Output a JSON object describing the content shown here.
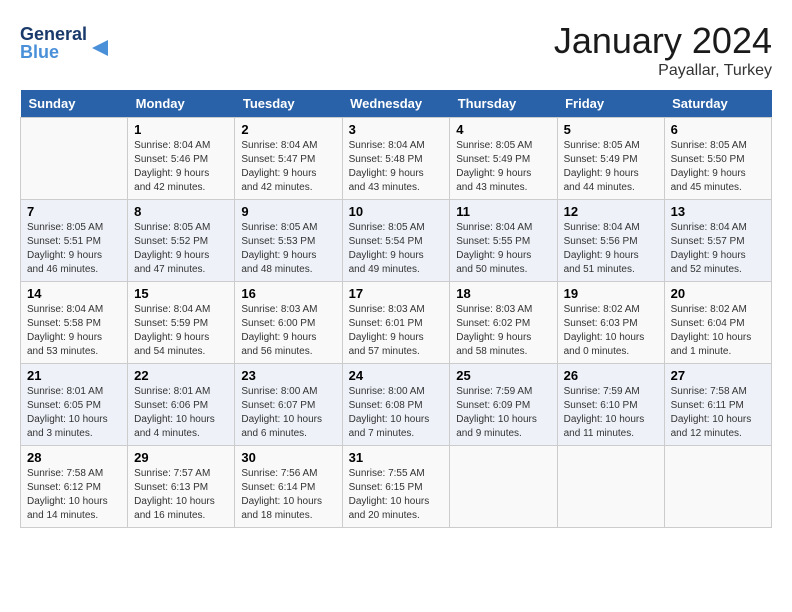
{
  "header": {
    "logo_general": "General",
    "logo_blue": "Blue",
    "month": "January 2024",
    "location": "Payallar, Turkey"
  },
  "weekdays": [
    "Sunday",
    "Monday",
    "Tuesday",
    "Wednesday",
    "Thursday",
    "Friday",
    "Saturday"
  ],
  "weeks": [
    [
      {
        "day": "",
        "info": ""
      },
      {
        "day": "1",
        "info": "Sunrise: 8:04 AM\nSunset: 5:46 PM\nDaylight: 9 hours\nand 42 minutes."
      },
      {
        "day": "2",
        "info": "Sunrise: 8:04 AM\nSunset: 5:47 PM\nDaylight: 9 hours\nand 42 minutes."
      },
      {
        "day": "3",
        "info": "Sunrise: 8:04 AM\nSunset: 5:48 PM\nDaylight: 9 hours\nand 43 minutes."
      },
      {
        "day": "4",
        "info": "Sunrise: 8:05 AM\nSunset: 5:49 PM\nDaylight: 9 hours\nand 43 minutes."
      },
      {
        "day": "5",
        "info": "Sunrise: 8:05 AM\nSunset: 5:49 PM\nDaylight: 9 hours\nand 44 minutes."
      },
      {
        "day": "6",
        "info": "Sunrise: 8:05 AM\nSunset: 5:50 PM\nDaylight: 9 hours\nand 45 minutes."
      }
    ],
    [
      {
        "day": "7",
        "info": "Sunrise: 8:05 AM\nSunset: 5:51 PM\nDaylight: 9 hours\nand 46 minutes."
      },
      {
        "day": "8",
        "info": "Sunrise: 8:05 AM\nSunset: 5:52 PM\nDaylight: 9 hours\nand 47 minutes."
      },
      {
        "day": "9",
        "info": "Sunrise: 8:05 AM\nSunset: 5:53 PM\nDaylight: 9 hours\nand 48 minutes."
      },
      {
        "day": "10",
        "info": "Sunrise: 8:05 AM\nSunset: 5:54 PM\nDaylight: 9 hours\nand 49 minutes."
      },
      {
        "day": "11",
        "info": "Sunrise: 8:04 AM\nSunset: 5:55 PM\nDaylight: 9 hours\nand 50 minutes."
      },
      {
        "day": "12",
        "info": "Sunrise: 8:04 AM\nSunset: 5:56 PM\nDaylight: 9 hours\nand 51 minutes."
      },
      {
        "day": "13",
        "info": "Sunrise: 8:04 AM\nSunset: 5:57 PM\nDaylight: 9 hours\nand 52 minutes."
      }
    ],
    [
      {
        "day": "14",
        "info": "Sunrise: 8:04 AM\nSunset: 5:58 PM\nDaylight: 9 hours\nand 53 minutes."
      },
      {
        "day": "15",
        "info": "Sunrise: 8:04 AM\nSunset: 5:59 PM\nDaylight: 9 hours\nand 54 minutes."
      },
      {
        "day": "16",
        "info": "Sunrise: 8:03 AM\nSunset: 6:00 PM\nDaylight: 9 hours\nand 56 minutes."
      },
      {
        "day": "17",
        "info": "Sunrise: 8:03 AM\nSunset: 6:01 PM\nDaylight: 9 hours\nand 57 minutes."
      },
      {
        "day": "18",
        "info": "Sunrise: 8:03 AM\nSunset: 6:02 PM\nDaylight: 9 hours\nand 58 minutes."
      },
      {
        "day": "19",
        "info": "Sunrise: 8:02 AM\nSunset: 6:03 PM\nDaylight: 10 hours\nand 0 minutes."
      },
      {
        "day": "20",
        "info": "Sunrise: 8:02 AM\nSunset: 6:04 PM\nDaylight: 10 hours\nand 1 minute."
      }
    ],
    [
      {
        "day": "21",
        "info": "Sunrise: 8:01 AM\nSunset: 6:05 PM\nDaylight: 10 hours\nand 3 minutes."
      },
      {
        "day": "22",
        "info": "Sunrise: 8:01 AM\nSunset: 6:06 PM\nDaylight: 10 hours\nand 4 minutes."
      },
      {
        "day": "23",
        "info": "Sunrise: 8:00 AM\nSunset: 6:07 PM\nDaylight: 10 hours\nand 6 minutes."
      },
      {
        "day": "24",
        "info": "Sunrise: 8:00 AM\nSunset: 6:08 PM\nDaylight: 10 hours\nand 7 minutes."
      },
      {
        "day": "25",
        "info": "Sunrise: 7:59 AM\nSunset: 6:09 PM\nDaylight: 10 hours\nand 9 minutes."
      },
      {
        "day": "26",
        "info": "Sunrise: 7:59 AM\nSunset: 6:10 PM\nDaylight: 10 hours\nand 11 minutes."
      },
      {
        "day": "27",
        "info": "Sunrise: 7:58 AM\nSunset: 6:11 PM\nDaylight: 10 hours\nand 12 minutes."
      }
    ],
    [
      {
        "day": "28",
        "info": "Sunrise: 7:58 AM\nSunset: 6:12 PM\nDaylight: 10 hours\nand 14 minutes."
      },
      {
        "day": "29",
        "info": "Sunrise: 7:57 AM\nSunset: 6:13 PM\nDaylight: 10 hours\nand 16 minutes."
      },
      {
        "day": "30",
        "info": "Sunrise: 7:56 AM\nSunset: 6:14 PM\nDaylight: 10 hours\nand 18 minutes."
      },
      {
        "day": "31",
        "info": "Sunrise: 7:55 AM\nSunset: 6:15 PM\nDaylight: 10 hours\nand 20 minutes."
      },
      {
        "day": "",
        "info": ""
      },
      {
        "day": "",
        "info": ""
      },
      {
        "day": "",
        "info": ""
      }
    ]
  ]
}
